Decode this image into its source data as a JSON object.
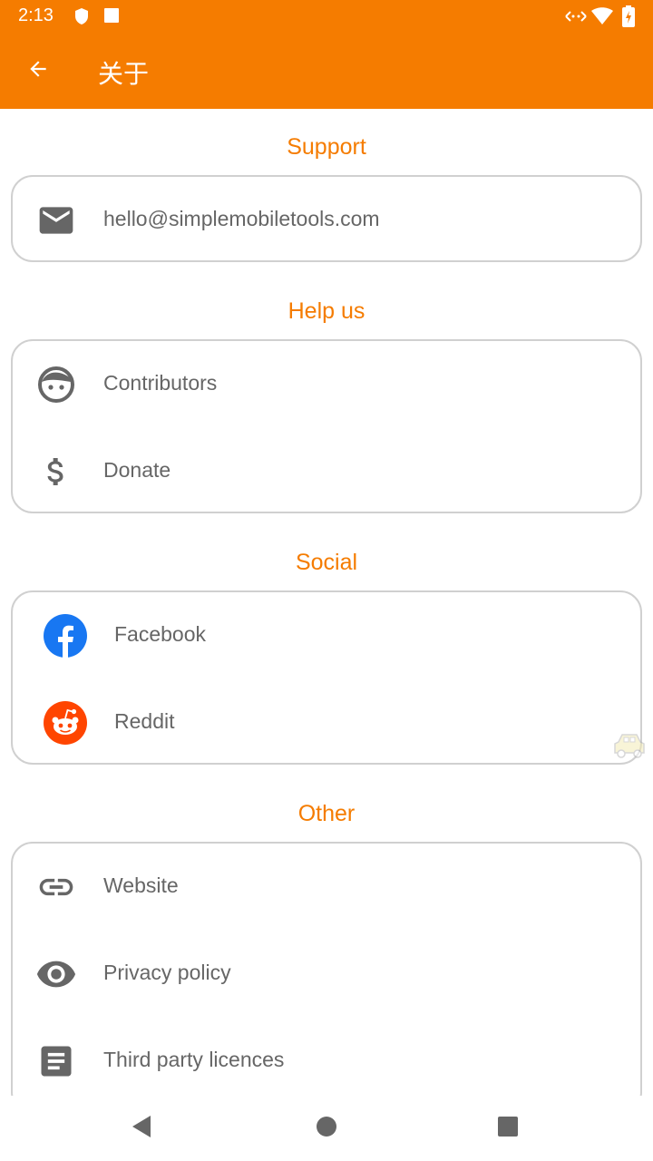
{
  "status_bar": {
    "time": "2:13",
    "icons": [
      "shield-icon",
      "square-icon",
      "data-transfer-icon",
      "wifi-icon",
      "battery-charging-icon"
    ]
  },
  "toolbar": {
    "back_icon": "arrow-back-icon",
    "title": "关于"
  },
  "sections": {
    "support": {
      "title": "Support",
      "items": [
        {
          "label": "hello@simplemobiletools.com",
          "icon": "email-icon"
        }
      ]
    },
    "help": {
      "title": "Help us",
      "items": [
        {
          "label": "Contributors",
          "icon": "face-icon"
        },
        {
          "label": "Donate",
          "icon": "dollar-icon"
        }
      ]
    },
    "social": {
      "title": "Social",
      "items": [
        {
          "label": "Facebook",
          "icon": "facebook-icon"
        },
        {
          "label": "Reddit",
          "icon": "reddit-icon"
        }
      ]
    },
    "other": {
      "title": "Other",
      "items": [
        {
          "label": "Website",
          "icon": "link-icon"
        },
        {
          "label": "Privacy policy",
          "icon": "eye-icon"
        },
        {
          "label": "Third party licences",
          "icon": "document-icon"
        }
      ]
    }
  },
  "nav_bar": {
    "buttons": [
      "back-triangle-icon",
      "home-circle-icon",
      "recents-square-icon"
    ]
  },
  "colors": {
    "accent": "#f57c00",
    "icon_gray": "#666666",
    "facebook": "#1877f2",
    "reddit": "#ff4500"
  }
}
